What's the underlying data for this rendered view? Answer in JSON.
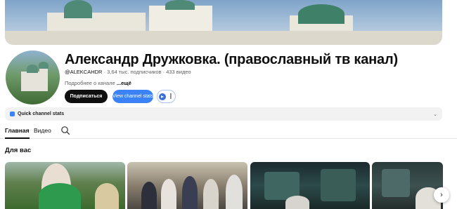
{
  "channel": {
    "name": "Александр Дружковка. (православный тв канал)",
    "handle": "@ALEKCAHDR",
    "stats": "· 3,64 тыс. подписчиков · 433 видео",
    "about_text": "Подробнее о канале",
    "about_more": "...ещё"
  },
  "buttons": {
    "subscribe": "Подписаться",
    "view_stats": "View channel stats",
    "more_icon": "⋮"
  },
  "quick_stats": {
    "label": "Quick channel stats",
    "chevron": "⌄"
  },
  "tabs": [
    {
      "label": "Главная",
      "active": true
    },
    {
      "label": "Видео",
      "active": false
    }
  ],
  "section": {
    "title": "Для вас"
  },
  "icons": {
    "search": "search-icon",
    "next": "chevron-right-icon",
    "extension": "extension-icon"
  },
  "colors": {
    "subscribe_bg": "#0f0f0f",
    "stats_bg": "#3b82f6",
    "quick_bar_bg": "#f2f2f2"
  }
}
